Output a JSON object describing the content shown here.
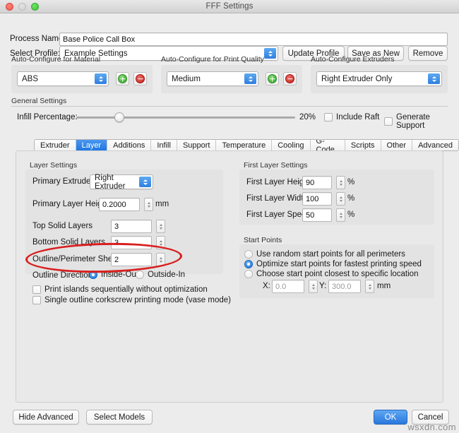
{
  "window": {
    "title": "FFF Settings",
    "traffic_lights": [
      "close-button",
      "minimize-button",
      "maximize-button"
    ]
  },
  "top_form": {
    "process_name_label": "Process Name:",
    "process_name_value": "Base Police Call Box",
    "select_profile_label": "Select Profile:",
    "select_profile_value": "Example Settings",
    "update_profile_label": "Update Profile",
    "save_as_new_label": "Save as New",
    "remove_label": "Remove"
  },
  "auto_configure": {
    "material": {
      "group_label": "Auto-Configure for Material",
      "value": "ABS",
      "add_label": "+",
      "remove_label": "−"
    },
    "print_quality": {
      "group_label": "Auto-Configure for Print Quality",
      "value": "Medium",
      "add_label": "+",
      "remove_label": "−"
    },
    "extruders": {
      "group_label": "Auto-Configure Extruders",
      "value": "Right Extruder Only"
    }
  },
  "general_settings": {
    "group_label": "General Settings",
    "infill_label": "Infill Percentage:",
    "infill_value": "20%",
    "infill_percent": 20,
    "include_raft_label": "Include Raft",
    "include_raft_checked": false,
    "generate_support_label": "Generate Support",
    "generate_support_checked": false
  },
  "tabs": {
    "items": [
      {
        "label": "Extruder",
        "active": false
      },
      {
        "label": "Layer",
        "active": true
      },
      {
        "label": "Additions",
        "active": false
      },
      {
        "label": "Infill",
        "active": false
      },
      {
        "label": "Support",
        "active": false
      },
      {
        "label": "Temperature",
        "active": false
      },
      {
        "label": "Cooling",
        "active": false
      },
      {
        "label": "G-Code",
        "active": false
      },
      {
        "label": "Scripts",
        "active": false
      },
      {
        "label": "Other",
        "active": false
      },
      {
        "label": "Advanced",
        "active": false
      }
    ]
  },
  "layer_settings": {
    "group_label": "Layer Settings",
    "primary_extruder_label": "Primary Extruder",
    "primary_extruder_value": "Right Extruder",
    "primary_layer_height_label": "Primary Layer Height",
    "primary_layer_height_value": "0.2000",
    "primary_layer_height_unit": "mm",
    "top_solid_layers_label": "Top Solid Layers",
    "top_solid_layers_value": "3",
    "bottom_solid_layers_label": "Bottom Solid Layers",
    "bottom_solid_layers_value": "3",
    "outline_shells_label": "Outline/Perimeter Shells",
    "outline_shells_value": "2",
    "outline_direction_label": "Outline Direction:",
    "outline_direction_inside_out": "Inside-Out",
    "outline_direction_outside_in": "Outside-In",
    "outline_direction_selected": "Inside-Out",
    "print_islands_label": "Print islands sequentially without optimization",
    "print_islands_checked": false,
    "vase_mode_label": "Single outline corkscrew printing mode (vase mode)",
    "vase_mode_checked": false
  },
  "first_layer_settings": {
    "group_label": "First Layer Settings",
    "height_label": "First Layer Height",
    "height_value": "90",
    "height_unit": "%",
    "width_label": "First Layer Width",
    "width_value": "100",
    "width_unit": "%",
    "speed_label": "First Layer Speed",
    "speed_value": "50",
    "speed_unit": "%"
  },
  "start_points": {
    "group_label": "Start Points",
    "option_random": "Use random start points for all perimeters",
    "option_optimize": "Optimize start points for fastest printing speed",
    "option_specific": "Choose start point closest to specific location",
    "selected": "Optimize start points for fastest printing speed",
    "x_label": "X:",
    "x_value": "0.0",
    "y_label": "Y:",
    "y_value": "300.0",
    "unit": "mm"
  },
  "footer": {
    "hide_advanced_label": "Hide Advanced",
    "select_models_label": "Select Models",
    "ok_label": "OK",
    "cancel_label": "Cancel"
  },
  "annotation": {
    "shape": "red-ellipse",
    "color": "#d81f1f",
    "target": "Outline/Perimeter Shells"
  },
  "watermark": {
    "text": "wsxdn.com"
  },
  "colors": {
    "accent_blue": "#2a78de",
    "window_bg": "#ececec",
    "panel_bg": "#e9e9e9",
    "group_bg": "#e3e3e3",
    "annotation_red": "#d81f1f"
  }
}
